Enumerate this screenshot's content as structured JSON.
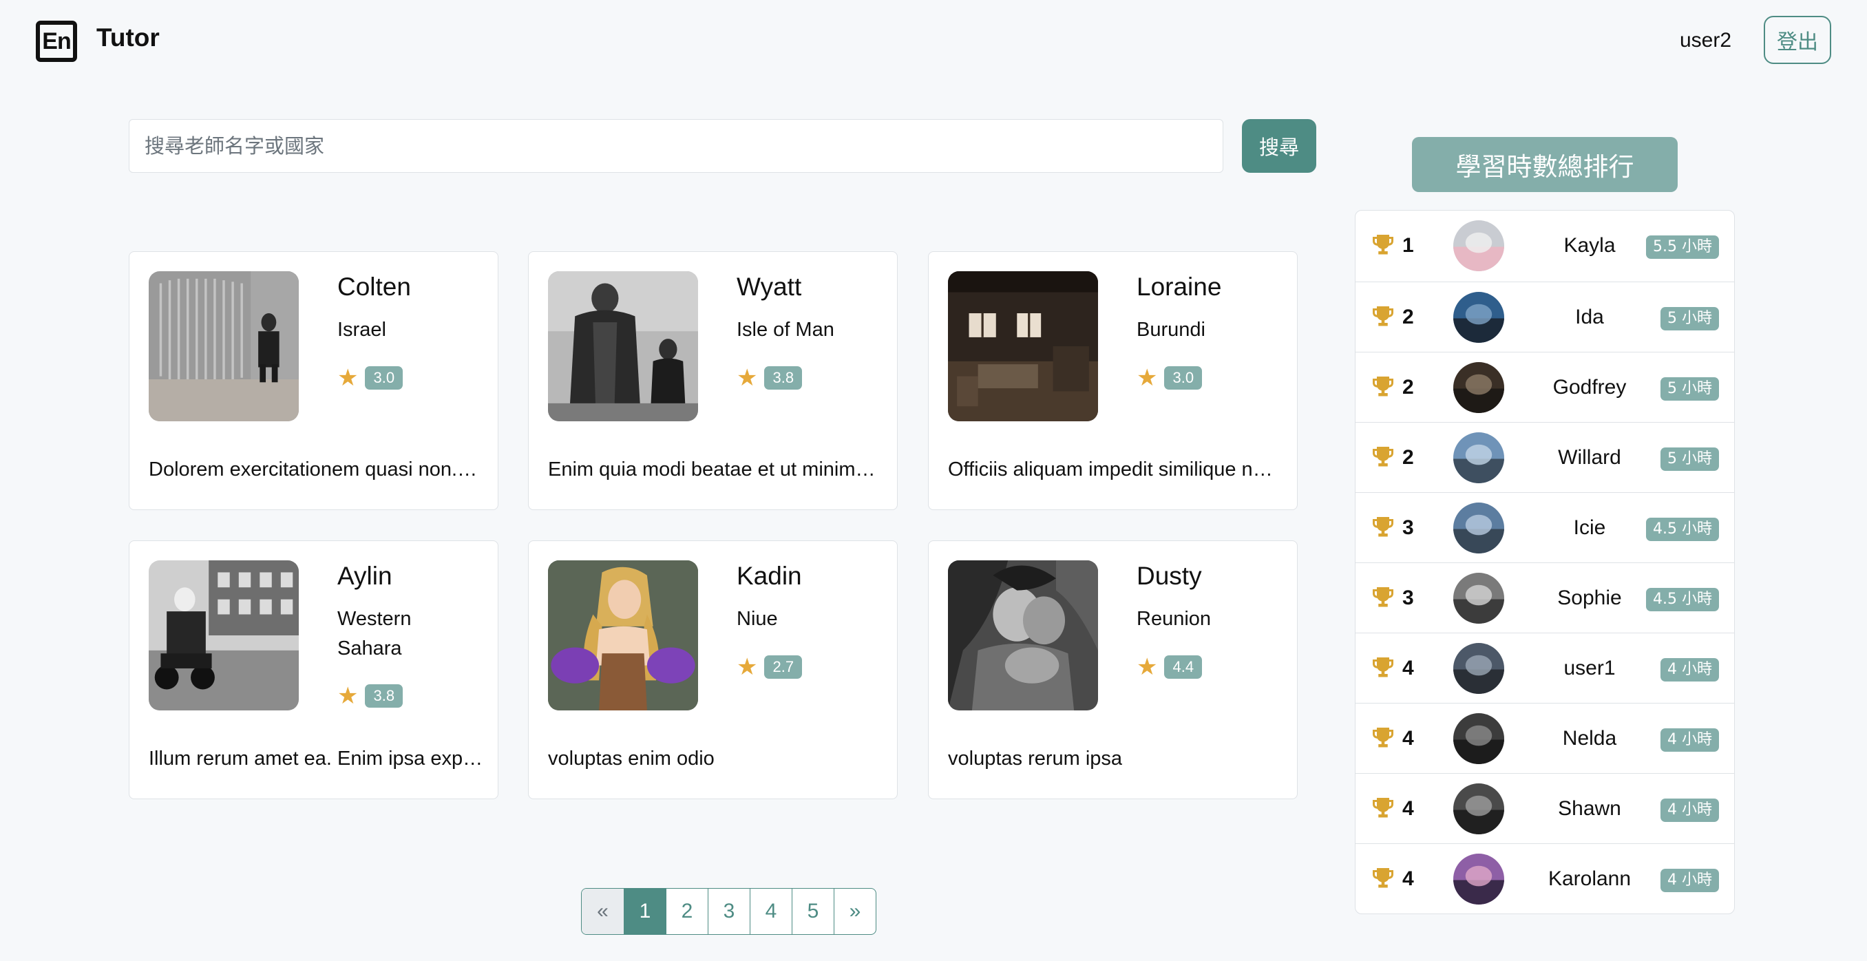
{
  "navbar": {
    "logo_text": "En",
    "brand": "Tutor",
    "username": "user2",
    "logout_label": "登出"
  },
  "search": {
    "placeholder": "搜尋老師名字或國家",
    "value": "",
    "button_label": "搜尋"
  },
  "teachers": [
    {
      "name": "Colten",
      "country": "Israel",
      "rating": "3.0",
      "intro": "Dolorem exercitationem quasi non.…",
      "avatar": "photo-corrugated-wall-man"
    },
    {
      "name": "Wyatt",
      "country": "Isle of Man",
      "rating": "3.8",
      "intro": "Enim quia modi beatae et ut minim…",
      "avatar": "photo-two-men-coats"
    },
    {
      "name": "Loraine",
      "country": "Burundi",
      "rating": "3.0",
      "intro": "Officiis aliquam impedit similique n…",
      "avatar": "photo-old-wooden-room"
    },
    {
      "name": "Aylin",
      "country": "Western Sahara",
      "rating": "3.8",
      "intro": "Illum rerum amet ea. Enim ipsa exp…",
      "avatar": "photo-street-scooter"
    },
    {
      "name": "Kadin",
      "country": "Niue",
      "rating": "2.7",
      "intro": "voluptas enim odio",
      "avatar": "photo-woman-purple-dress"
    },
    {
      "name": "Dusty",
      "country": "Reunion",
      "rating": "4.4",
      "intro": "voluptas rerum ipsa",
      "avatar": "photo-embracing-couple"
    }
  ],
  "pagination": {
    "prev": "«",
    "pages": [
      "1",
      "2",
      "3",
      "4",
      "5"
    ],
    "next": "»",
    "active_page": "1"
  },
  "leaderboard": {
    "title": "學習時數總排行",
    "entries": [
      {
        "rank": "1",
        "name": "Kayla",
        "hours": "5.5 小時"
      },
      {
        "rank": "2",
        "name": "Ida",
        "hours": "5 小時"
      },
      {
        "rank": "2",
        "name": "Godfrey",
        "hours": "5 小時"
      },
      {
        "rank": "2",
        "name": "Willard",
        "hours": "5 小時"
      },
      {
        "rank": "3",
        "name": "Icie",
        "hours": "4.5 小時"
      },
      {
        "rank": "3",
        "name": "Sophie",
        "hours": "4.5 小時"
      },
      {
        "rank": "4",
        "name": "user1",
        "hours": "4 小時"
      },
      {
        "rank": "4",
        "name": "Nelda",
        "hours": "4 小時"
      },
      {
        "rank": "4",
        "name": "Shawn",
        "hours": "4 小時"
      },
      {
        "rank": "4",
        "name": "Karolann",
        "hours": "4 小時"
      }
    ]
  },
  "colors": {
    "primary": "#4e8c84",
    "badge": "#84aeaa",
    "star": "#e6a93a",
    "trophy": "#d9a431",
    "background": "#f6f8fa"
  },
  "icons": {
    "star": "star-icon",
    "trophy": "trophy-icon"
  }
}
